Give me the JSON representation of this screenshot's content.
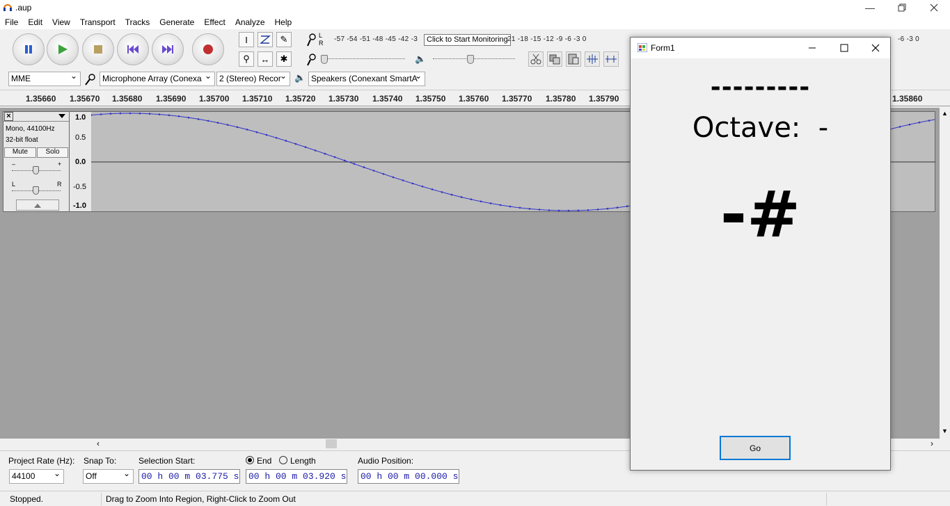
{
  "window": {
    "title": ".aup"
  },
  "menubar": {
    "items": [
      "File",
      "Edit",
      "View",
      "Transport",
      "Tracks",
      "Generate",
      "Effect",
      "Analyze",
      "Help"
    ]
  },
  "meters": {
    "rec_scale": "-57 -54 -51 -48 -45 -42 -3",
    "rec_scale_tail": "21 -18 -15 -12  -9  -6  -3  0",
    "tooltip": "Click to Start Monitoring",
    "play_scale_tail": "-6  -3  0",
    "lr_label": "L R"
  },
  "device_toolbar": {
    "host": "MME",
    "recording_device": "Microphone Array (Conexa",
    "channels": "2 (Stereo) Recor",
    "playback_device": "Speakers (Conexant SmartA"
  },
  "ruler": {
    "ticks": [
      "1.35660",
      "1.35670",
      "1.35680",
      "1.35690",
      "1.35700",
      "1.35710",
      "1.35720",
      "1.35730",
      "1.35740",
      "1.35750",
      "1.35760",
      "1.35770",
      "1.35780",
      "1.35790",
      "1.35860"
    ]
  },
  "track": {
    "format": "Mono, 44100Hz",
    "bit_depth": "32-bit float",
    "mute_label": "Mute",
    "solo_label": "Solo",
    "gain_minus": "–",
    "gain_plus": "+",
    "pan_left": "L",
    "pan_right": "R",
    "vruler": [
      "1.0",
      "0.5",
      "0.0",
      "-0.5",
      "-1.0"
    ]
  },
  "selection_bar": {
    "project_rate_label": "Project Rate (Hz):",
    "project_rate": "44100",
    "snap_to_label": "Snap To:",
    "snap_to": "Off",
    "selection_start_label": "Selection Start:",
    "end_label": "End",
    "length_label": "Length",
    "audio_position_label": "Audio Position:",
    "selection_start": "00 h 00 m 03.775 s",
    "selection_end": "00 h 00 m 03.920 s",
    "audio_position": "00 h 00 m 00.000 s"
  },
  "status": {
    "state": "Stopped.",
    "hint": "Drag to Zoom Into Region, Right-Click to Zoom Out"
  },
  "form1": {
    "title": "Form1",
    "dashes": "---------",
    "octave_label": "Octave:  -",
    "note": "-#",
    "go_label": "Go"
  },
  "colors": {
    "wave_bg": "#bebebe",
    "wave_line": "#3232c8",
    "track_area_bg": "#a0a0a0",
    "play_green": "#3aa33a",
    "record_red": "#c03030",
    "pause_blue": "#2a5fd0"
  }
}
